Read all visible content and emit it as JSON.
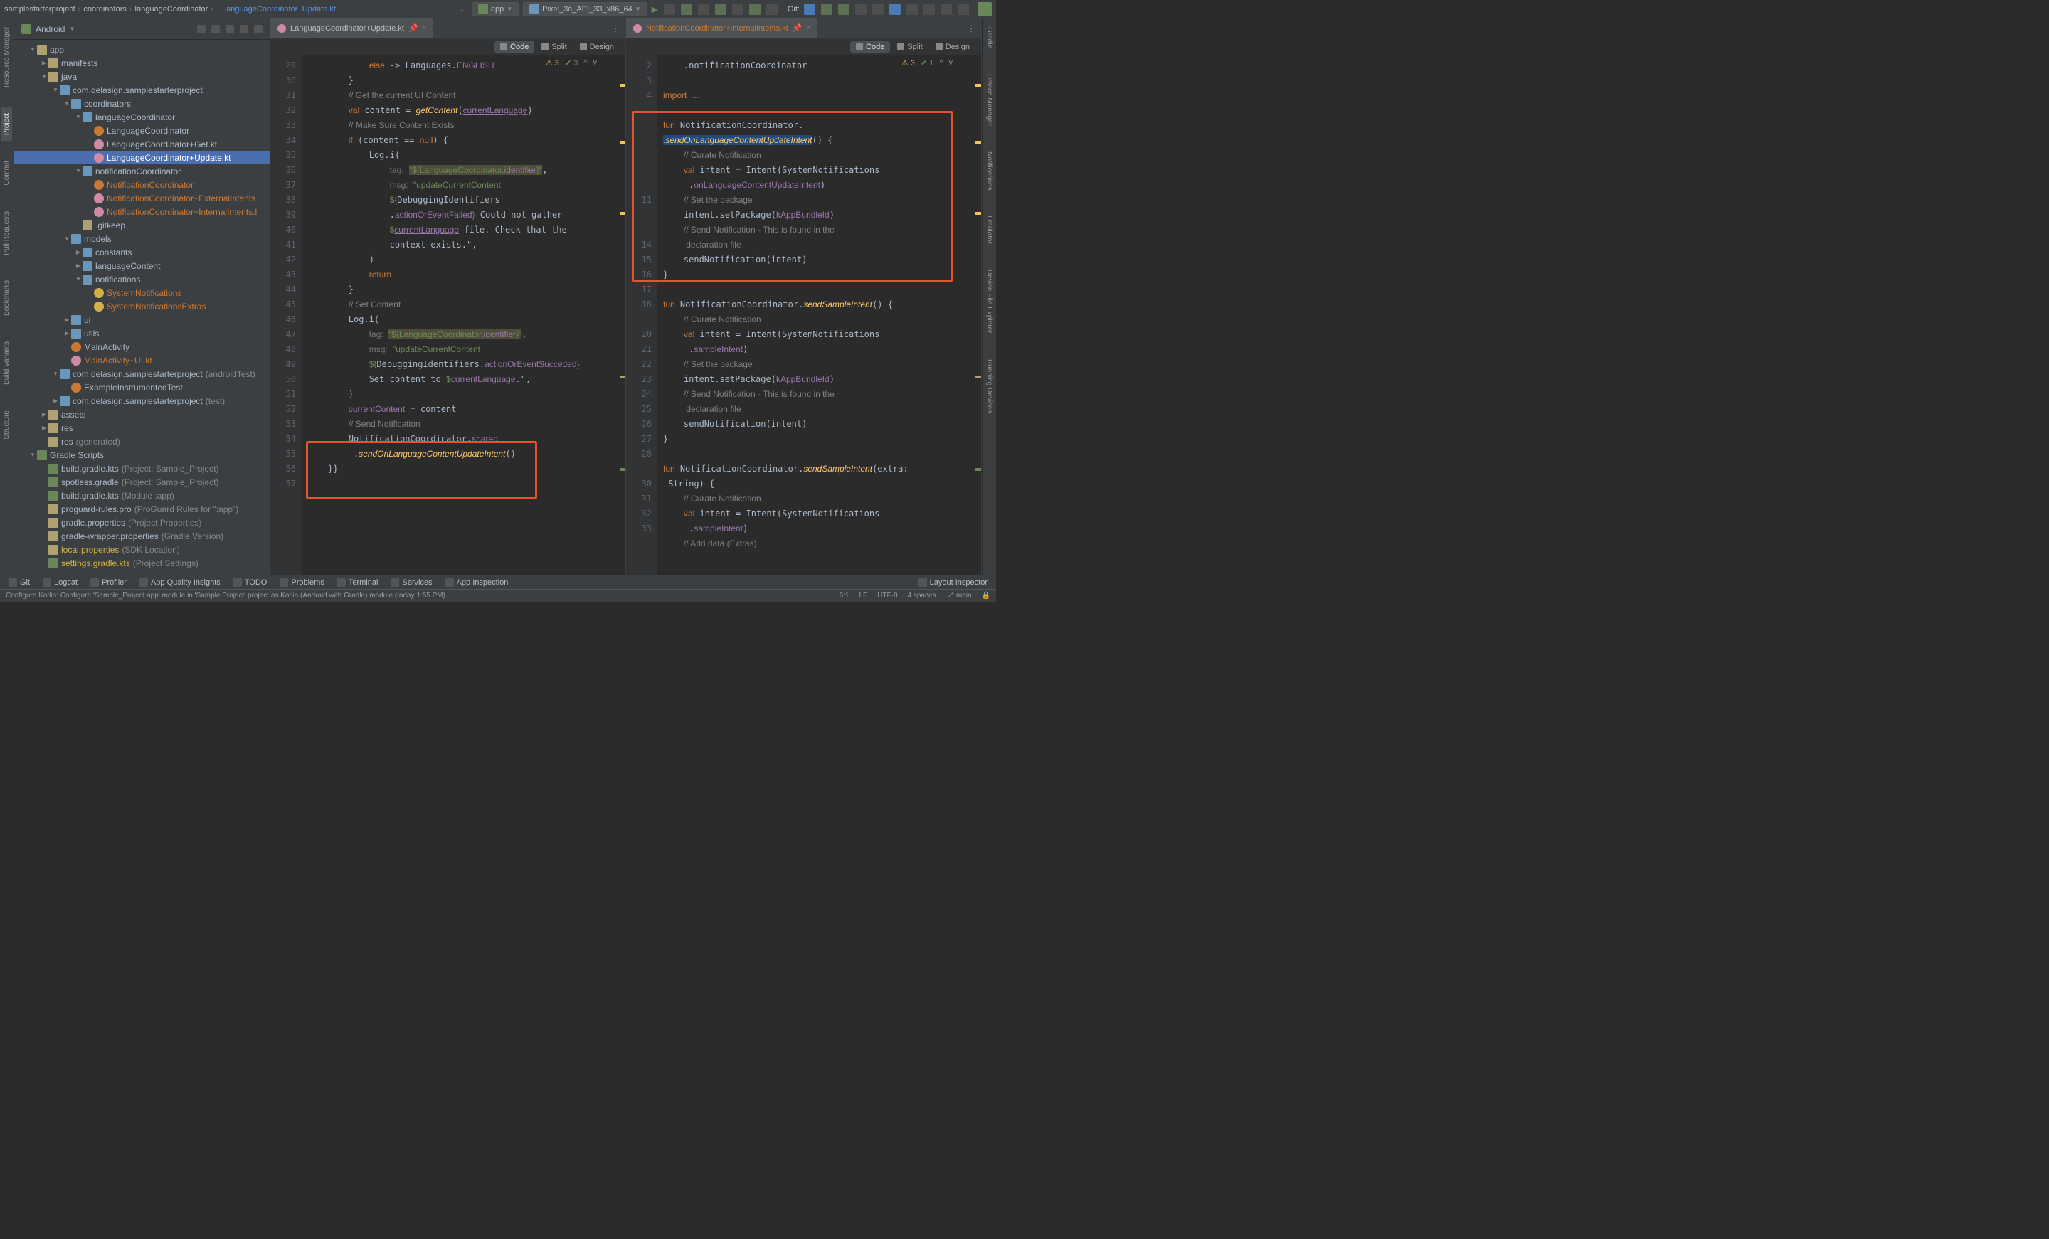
{
  "breadcrumb": [
    "samplestarterproject",
    "coordinators",
    "languageCoordinator",
    "LanguageCoordinator+Update.kt"
  ],
  "run_config": "app",
  "device": "Pixel_3a_API_33_x86_64",
  "git_label": "Git:",
  "sidebar": {
    "title": "Android",
    "tree": [
      {
        "d": 1,
        "t": "app",
        "i": "folder-ic",
        "exp": 1
      },
      {
        "d": 2,
        "t": "manifests",
        "i": "folder-ic",
        "exp": 0
      },
      {
        "d": 2,
        "t": "java",
        "i": "folder-ic",
        "exp": 1
      },
      {
        "d": 3,
        "t": "com.delasign.samplestarterproject",
        "i": "pk-ic",
        "exp": 1
      },
      {
        "d": 4,
        "t": "coordinators",
        "i": "pk-ic",
        "exp": 1
      },
      {
        "d": 5,
        "t": "languageCoordinator",
        "i": "pk-ic",
        "exp": 1
      },
      {
        "d": 6,
        "t": "LanguageCoordinator",
        "i": "cls-ic"
      },
      {
        "d": 6,
        "t": "LanguageCoordinator+Get.kt",
        "i": "kt-ic"
      },
      {
        "d": 6,
        "t": "LanguageCoordinator+Update.kt",
        "i": "kt-ic",
        "sel": 1
      },
      {
        "d": 5,
        "t": "notificationCoordinator",
        "i": "pk-ic",
        "exp": 1
      },
      {
        "d": 6,
        "t": "NotificationCoordinator",
        "i": "cls-ic",
        "orange": 1
      },
      {
        "d": 6,
        "t": "NotificationCoordinator+ExternalIntents.",
        "i": "kt-ic",
        "orange": 1
      },
      {
        "d": 6,
        "t": "NotificationCoordinator+InternalIntents.l",
        "i": "kt-ic",
        "orange": 1
      },
      {
        "d": 5,
        "t": ".gitkeep",
        "i": "folder-ic",
        "txt": 1
      },
      {
        "d": 4,
        "t": "models",
        "i": "pk-ic",
        "exp": 1
      },
      {
        "d": 5,
        "t": "constants",
        "i": "pk-ic",
        "exp": 0
      },
      {
        "d": 5,
        "t": "languageContent",
        "i": "pk-ic",
        "exp": 0
      },
      {
        "d": 5,
        "t": "notifications",
        "i": "pk-ic",
        "exp": 1
      },
      {
        "d": 6,
        "t": "SystemNotifications",
        "i": "yel-ic",
        "orange": 1
      },
      {
        "d": 6,
        "t": "SystemNotificationsExtras",
        "i": "yel-ic",
        "orange": 1
      },
      {
        "d": 4,
        "t": "ui",
        "i": "pk-ic",
        "exp": 0
      },
      {
        "d": 4,
        "t": "utils",
        "i": "pk-ic",
        "exp": 0
      },
      {
        "d": 4,
        "t": "MainActivity",
        "i": "cls-ic"
      },
      {
        "d": 4,
        "t": "MainActivity+UI.kt",
        "i": "kt-ic",
        "orange": 1
      },
      {
        "d": 3,
        "t": "com.delasign.samplestarterproject",
        "i": "pk-ic",
        "grey": "(androidTest)",
        "exp": 1
      },
      {
        "d": 4,
        "t": "ExampleInstrumentedTest",
        "i": "cls-ic"
      },
      {
        "d": 3,
        "t": "com.delasign.samplestarterproject",
        "i": "pk-ic",
        "grey": "(test)",
        "exp": 0
      },
      {
        "d": 2,
        "t": "assets",
        "i": "folder-ic",
        "exp": 0
      },
      {
        "d": 2,
        "t": "res",
        "i": "folder-ic",
        "exp": 0
      },
      {
        "d": 2,
        "t": "res",
        "i": "folder-ic",
        "grey": "(generated)"
      },
      {
        "d": 1,
        "t": "Gradle Scripts",
        "i": "gr-ic",
        "exp": 1
      },
      {
        "d": 2,
        "t": "build.gradle.kts",
        "i": "gr-ic",
        "grey": "(Project: Sample_Project)"
      },
      {
        "d": 2,
        "t": "spotless.gradle",
        "i": "gr-ic",
        "grey": "(Project: Sample_Project)"
      },
      {
        "d": 2,
        "t": "build.gradle.kts",
        "i": "gr-ic",
        "grey": "(Module :app)"
      },
      {
        "d": 2,
        "t": "proguard-rules.pro",
        "i": "folder-ic",
        "grey": "(ProGuard Rules for \":app\")"
      },
      {
        "d": 2,
        "t": "gradle.properties",
        "i": "folder-ic",
        "grey": "(Project Properties)"
      },
      {
        "d": 2,
        "t": "gradle-wrapper.properties",
        "i": "folder-ic",
        "grey": "(Gradle Version)"
      },
      {
        "d": 2,
        "t": "local.properties",
        "i": "folder-ic",
        "grey": "(SDK Location)",
        "yellow": 1
      },
      {
        "d": 2,
        "t": "settings.gradle.kts",
        "i": "gr-ic",
        "grey": "(Project Settings)",
        "yellow": 1
      }
    ]
  },
  "left_tabs": [
    "Resource Manager",
    "Project",
    "Commit",
    "Pull Requests",
    "Bookmarks",
    "Build Variants",
    "Structure"
  ],
  "right_tabs": [
    "Gradle",
    "Device Manager",
    "Notifications",
    "Emulator",
    "Device File Explorer",
    "Running Devices"
  ],
  "editor1": {
    "tab": "LanguageCoordinator+Update.kt",
    "view": [
      "Code",
      "Split",
      "Design"
    ],
    "warn": "3",
    "ok": "3",
    "line_start": 29,
    "lines": [
      "            <span class='kw'>else</span> -> Languages.<span class='id'>ENGLISH</span>",
      "        }",
      "        <span class='com'>// Get the current UI Content</span>",
      "        <span class='kw'>val</span> content = <span class='fn'>getContent</span>(<span class='id underline'>currentLanguage</span>)",
      "        <span class='com'>// Make Sure Content Exists</span>",
      "        <span class='kw'>if</span> (content == <span class='kw'>null</span>) {",
      "            Log.i(",
      "                <span class='param'>tag:</span> <span class='str hlbg'>\"${LanguageCoordinator.</span><span class='id hlbg'>identifier</span><span class='str hlbg'>}\"</span>,",
      "                <span class='param'>msg:</span> <span class='str'>\"updateCurrentContent </span>",
      "                <span class='str'>${</span>DebuggingIdentifiers",
      "                .<span class='id'>actionOrEventFailed</span><span class='str'>}</span> Could not gather ",
      "                <span class='str'>$</span><span class='id underline'>currentLanguage</span> file. Check that the ",
      "                context exists.\",",
      "            )",
      "            <span class='kw'>return</span>",
      "        }",
      "        <span class='com'>// Set Content</span>",
      "        Log.i(",
      "            <span class='param'>tag:</span> <span class='str hlbg'>\"${LanguageCoordinator.</span><span class='id hlbg'>identifier</span><span class='str hlbg'>}\"</span>,",
      "            <span class='param'>msg:</span> <span class='str'>\"updateCurrentContent </span>",
      "            <span class='str'>${</span>DebuggingIdentifiers.<span class='id'>actionOrEventSucceded</span><span class='str'>}</span> ",
      "            Set content to <span class='str'>$</span><span class='id underline'>currentLanguage</span>.\",",
      "        )",
      "        <span class='id underline'>currentContent</span> = content",
      "        <span class='com'>// Send Notification</span>",
      "        NotificationCoordinator.<span class='id'>shared</span>",
      "         .<span class='fn'>sendOnLanguageContentUpdateIntent</span>()",
      "    }}",
      ""
    ]
  },
  "editor2": {
    "tab": "NotificationCoordinator+InternalIntents.kt",
    "view": [
      "Code",
      "Split",
      "Design"
    ],
    "warn": "3",
    "ok": "1",
    "line_start": 2,
    "lines": [
      "    .notificationCoordinator",
      "",
      "<span class='kw'>import</span> <span class='com'>...</span>",
      "",
      "<span class='kw'>fun</span> NotificationCoordinator.",
      "<span class='selbg'>.<span class='fn'>sendOnLanguageContentUpdateIntent</span></span>() {",
      "    <span class='com'>// Curate Notification</span>",
      "    <span class='kw'>val</span> intent = Intent(SystemNotifications",
      "     .<span class='id'>onLanguageContentUpdateIntent</span>)",
      "    <span class='com'>// Set the package</span>",
      "    intent.setPackage(<span class='id'>kAppBundleId</span>)",
      "    <span class='com'>// Send Notification - This is found in the </span>",
      "    <span class='com'> declaration file</span>",
      "    sendNotification(intent)",
      "}",
      "",
      "<span class='kw'>fun</span> NotificationCoordinator.<span class='fn'>sendSampleIntent</span>() {",
      "    <span class='com'>// Curate Notification</span>",
      "    <span class='kw'>val</span> intent = Intent(SystemNotifications",
      "     .<span class='id'>sampleIntent</span>)",
      "    <span class='com'>// Set the package</span>",
      "    intent.setPackage(<span class='id'>kAppBundleId</span>)",
      "    <span class='com'>// Send Notification - This is found in the </span>",
      "    <span class='com'> declaration file</span>",
      "    sendNotification(intent)",
      "}",
      "",
      "<span class='kw'>fun</span> NotificationCoordinator.<span class='fn'>sendSampleIntent</span>(extra: ",
      " String) {",
      "    <span class='com'>// Curate Notification</span>",
      "    <span class='kw'>val</span> intent = Intent(SystemNotifications",
      "     .<span class='id'>sampleIntent</span>)",
      "    <span class='com'>// Add data (Extras)</span>"
    ]
  },
  "bottom": [
    "Git",
    "Logcat",
    "Profiler",
    "App Quality Insights",
    "TODO",
    "Problems",
    "Terminal",
    "Services",
    "App Inspection"
  ],
  "layout_insp": "Layout Inspector",
  "status": {
    "msg": "Configure Kotlin: Configure 'Sample_Project.app' module in 'Sample Project' project as Kotlin (Android with Gradle) module (today 1:55 PM)",
    "pos": "6:1",
    "le": "LF",
    "enc": "UTF-8",
    "indent": "4 spaces",
    "branch": "main"
  }
}
